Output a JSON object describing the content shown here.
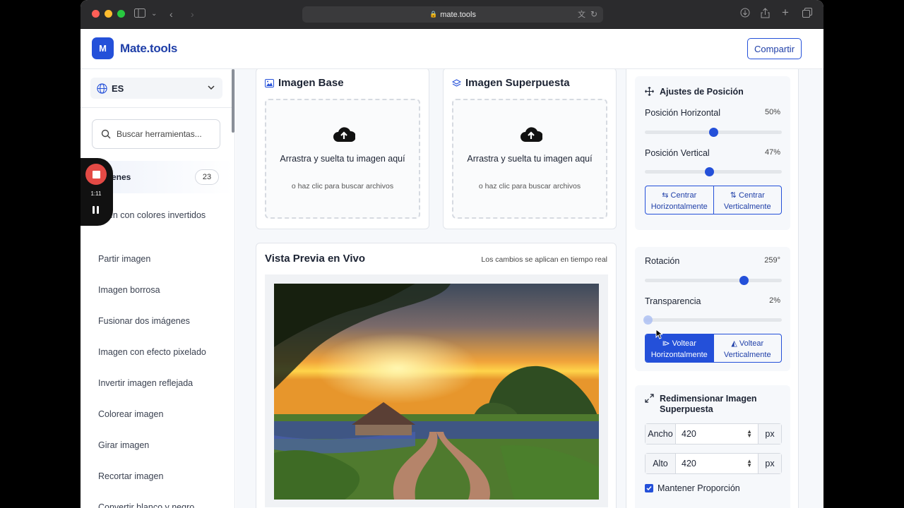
{
  "browser": {
    "url": "mate.tools"
  },
  "header": {
    "logo_letter": "M",
    "brand": "Mate.tools",
    "share_label": "Compartir"
  },
  "sidebar": {
    "language": "ES",
    "search_placeholder": "Buscar herramientas...",
    "category": {
      "label": "enes",
      "count": "23"
    },
    "items": [
      "agen con colores invertidos",
      "Partir imagen",
      "Imagen borrosa",
      "Fusionar dos imágenes",
      "Imagen con efecto pixelado",
      "Invertir imagen reflejada",
      "Colorear imagen",
      "Girar imagen",
      "Recortar imagen",
      "Convertir blanco y negro"
    ]
  },
  "recording": {
    "time": "1:11"
  },
  "upload": {
    "base_title": "Imagen Base",
    "overlay_title": "Imagen Superpuesta",
    "drop_text": "Arrastra y suelta tu imagen aquí",
    "drop_hint": "o haz clic para buscar archivos"
  },
  "preview": {
    "title": "Vista Previa en Vivo",
    "note": "Los cambios se aplican en tiempo real"
  },
  "position": {
    "title": "Ajustes de Posición",
    "horizontal_label": "Posición Horizontal",
    "horizontal_value": "50%",
    "horizontal": 0.5,
    "vertical_label": "Posición Vertical",
    "vertical_value": "47%",
    "vertical": 0.47,
    "center_h": "Centrar Horizontalmente",
    "center_v": "Centrar Verticalmente"
  },
  "transform": {
    "rotation_label": "Rotación",
    "rotation_value": "259°",
    "rotation": 259,
    "opacity_label": "Transparencia",
    "opacity_value": "2%",
    "opacity": 0.02,
    "flip_h": "Voltear Horizontalmente",
    "flip_v": "Voltear Verticalmente"
  },
  "resize": {
    "title": "Redimensionar Imagen Superpuesta",
    "width_label": "Ancho",
    "width_value": "420",
    "height_label": "Alto",
    "height_value": "420",
    "unit": "px",
    "keep_ratio": "Mantener Proporción"
  },
  "colors": {
    "accent": "#2450d9",
    "record": "#e34a45"
  }
}
